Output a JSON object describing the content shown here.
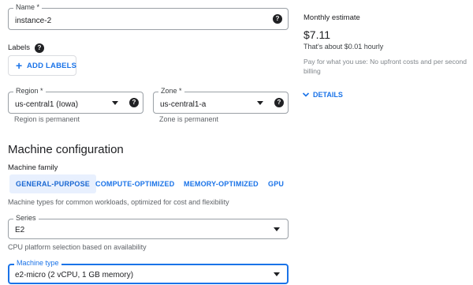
{
  "name_field": {
    "label": "Name *",
    "value": "instance-2"
  },
  "labels": {
    "title": "Labels",
    "add_button": "ADD LABELS"
  },
  "region": {
    "label": "Region *",
    "value": "us-central1 (Iowa)",
    "hint": "Region is permanent"
  },
  "zone": {
    "label": "Zone *",
    "value": "us-central1-a",
    "hint": "Zone is permanent"
  },
  "machine_config": {
    "title": "Machine configuration",
    "family_label": "Machine family",
    "families": [
      "GENERAL-PURPOSE",
      "COMPUTE-OPTIMIZED",
      "MEMORY-OPTIMIZED",
      "GPU"
    ],
    "selected_family": "GENERAL-PURPOSE",
    "family_hint": "Machine types for common workloads, optimized for cost and flexibility",
    "series": {
      "label": "Series",
      "value": "E2",
      "hint": "CPU platform selection based on availability"
    },
    "machine_type": {
      "label": "Machine type",
      "value": "e2-micro (2 vCPU, 1 GB memory)"
    }
  },
  "estimate": {
    "title": "Monthly estimate",
    "price": "$7.11",
    "hourly": "That's about $0.01 hourly",
    "note": "Pay for what you use: No upfront costs and per second billing",
    "details_label": "DETAILS"
  },
  "colors": {
    "accent": "#1a73e8",
    "chip_bg": "#e8f0fe",
    "border": "#9aa0a6"
  },
  "icons": {
    "help": "help-circle-icon",
    "dropdown": "caret-down-icon",
    "add": "plus-icon",
    "expand": "chevron-down-icon"
  }
}
